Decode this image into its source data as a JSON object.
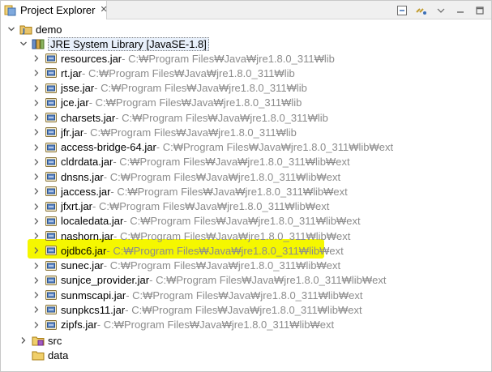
{
  "view": {
    "tab_title": "Project Explorer",
    "close_glyph": "✕",
    "toolbar": [
      "collapse-all-icon",
      "link-with-editor-icon",
      "view-menu-icon",
      "minimize-icon",
      "maximize-icon"
    ]
  },
  "tree": {
    "project": "demo",
    "library": "JRE System Library [JavaSE-1.8]",
    "jars": [
      {
        "name": "resources.jar",
        "path": " - C:₩Program Files₩Java₩jre1.8.0_311₩lib"
      },
      {
        "name": "rt.jar",
        "path": " - C:₩Program Files₩Java₩jre1.8.0_311₩lib"
      },
      {
        "name": "jsse.jar",
        "path": " - C:₩Program Files₩Java₩jre1.8.0_311₩lib"
      },
      {
        "name": "jce.jar",
        "path": " - C:₩Program Files₩Java₩jre1.8.0_311₩lib"
      },
      {
        "name": "charsets.jar",
        "path": " - C:₩Program Files₩Java₩jre1.8.0_311₩lib"
      },
      {
        "name": "jfr.jar",
        "path": " - C:₩Program Files₩Java₩jre1.8.0_311₩lib"
      },
      {
        "name": "access-bridge-64.jar",
        "path": " - C:₩Program Files₩Java₩jre1.8.0_311₩lib₩ext"
      },
      {
        "name": "cldrdata.jar",
        "path": " - C:₩Program Files₩Java₩jre1.8.0_311₩lib₩ext"
      },
      {
        "name": "dnsns.jar",
        "path": " - C:₩Program Files₩Java₩jre1.8.0_311₩lib₩ext"
      },
      {
        "name": "jaccess.jar",
        "path": " - C:₩Program Files₩Java₩jre1.8.0_311₩lib₩ext"
      },
      {
        "name": "jfxrt.jar",
        "path": " - C:₩Program Files₩Java₩jre1.8.0_311₩lib₩ext"
      },
      {
        "name": "localedata.jar",
        "path": " - C:₩Program Files₩Java₩jre1.8.0_311₩lib₩ext"
      },
      {
        "name": "nashorn.jar",
        "path": " - C:₩Program Files₩Java₩jre1.8.0_311₩lib₩ext"
      },
      {
        "name": "ojdbc6.jar",
        "path": " - C:₩Program Files₩Java₩jre1.8.0_311₩lib₩ext"
      },
      {
        "name": "sunec.jar",
        "path": " - C:₩Program Files₩Java₩jre1.8.0_311₩lib₩ext"
      },
      {
        "name": "sunjce_provider.jar",
        "path": " - C:₩Program Files₩Java₩jre1.8.0_311₩lib₩ext"
      },
      {
        "name": "sunmscapi.jar",
        "path": " - C:₩Program Files₩Java₩jre1.8.0_311₩lib₩ext"
      },
      {
        "name": "sunpkcs11.jar",
        "path": " - C:₩Program Files₩Java₩jre1.8.0_311₩lib₩ext"
      },
      {
        "name": "zipfs.jar",
        "path": " - C:₩Program Files₩Java₩jre1.8.0_311₩lib₩ext"
      }
    ],
    "folders": [
      "src",
      "data"
    ]
  },
  "colors": {
    "highlight": "#f5f700",
    "path_text": "#8c8c8c"
  }
}
